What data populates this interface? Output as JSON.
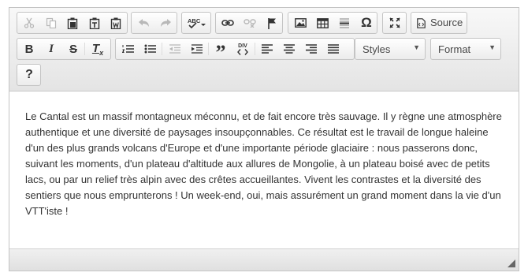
{
  "toolbar": {
    "row1": {
      "clipboard": [
        "cut-icon",
        "copy-icon",
        "paste-icon",
        "paste-text-icon",
        "paste-word-icon"
      ],
      "history": [
        "undo-icon",
        "redo-icon"
      ],
      "spellcheck": "spellcheck-icon",
      "spellcheck_text": "ABC",
      "links": [
        "link-icon",
        "unlink-icon",
        "anchor-icon"
      ],
      "insert": [
        "image-icon",
        "table-icon",
        "horizontal-rule-icon",
        "special-char-icon"
      ],
      "special_char_glyph": "Ω",
      "maximize": "maximize-icon",
      "source_label": "Source"
    },
    "row2": {
      "bold_glyph": "B",
      "italic_glyph": "I",
      "strike_glyph": "S",
      "remove_format_glyph": "T",
      "remove_format_sub": "x",
      "blockquote_glyph": "”",
      "div_glyph": "DIV",
      "styles_label": "Styles",
      "format_label": "Format"
    },
    "row3": {
      "help_glyph": "?"
    }
  },
  "content": {
    "text": "Le Cantal est un massif montagneux méconnu, et de fait encore très sauvage. Il y règne une atmosphère authentique et une diversité de paysages insoupçonnables. Ce résultat est le travail de longue haleine d'un des plus grands volcans d'Europe et d'une importante période glaciaire : nous passerons donc, suivant les moments, d'un plateau d'altitude aux allures de Mongolie, à un plateau boisé avec de petits lacs, ou par un relief très alpin avec des crêtes accueillantes. Vivent les contrastes et la diversité des sentiers que nous emprunterons ! Un week-end, oui, mais assurément un grand moment dans la vie d'un VTT'iste !"
  },
  "colors": {
    "border": "#c4c4c4",
    "text": "#333333",
    "disabled_icon": "#b8b8b8"
  }
}
